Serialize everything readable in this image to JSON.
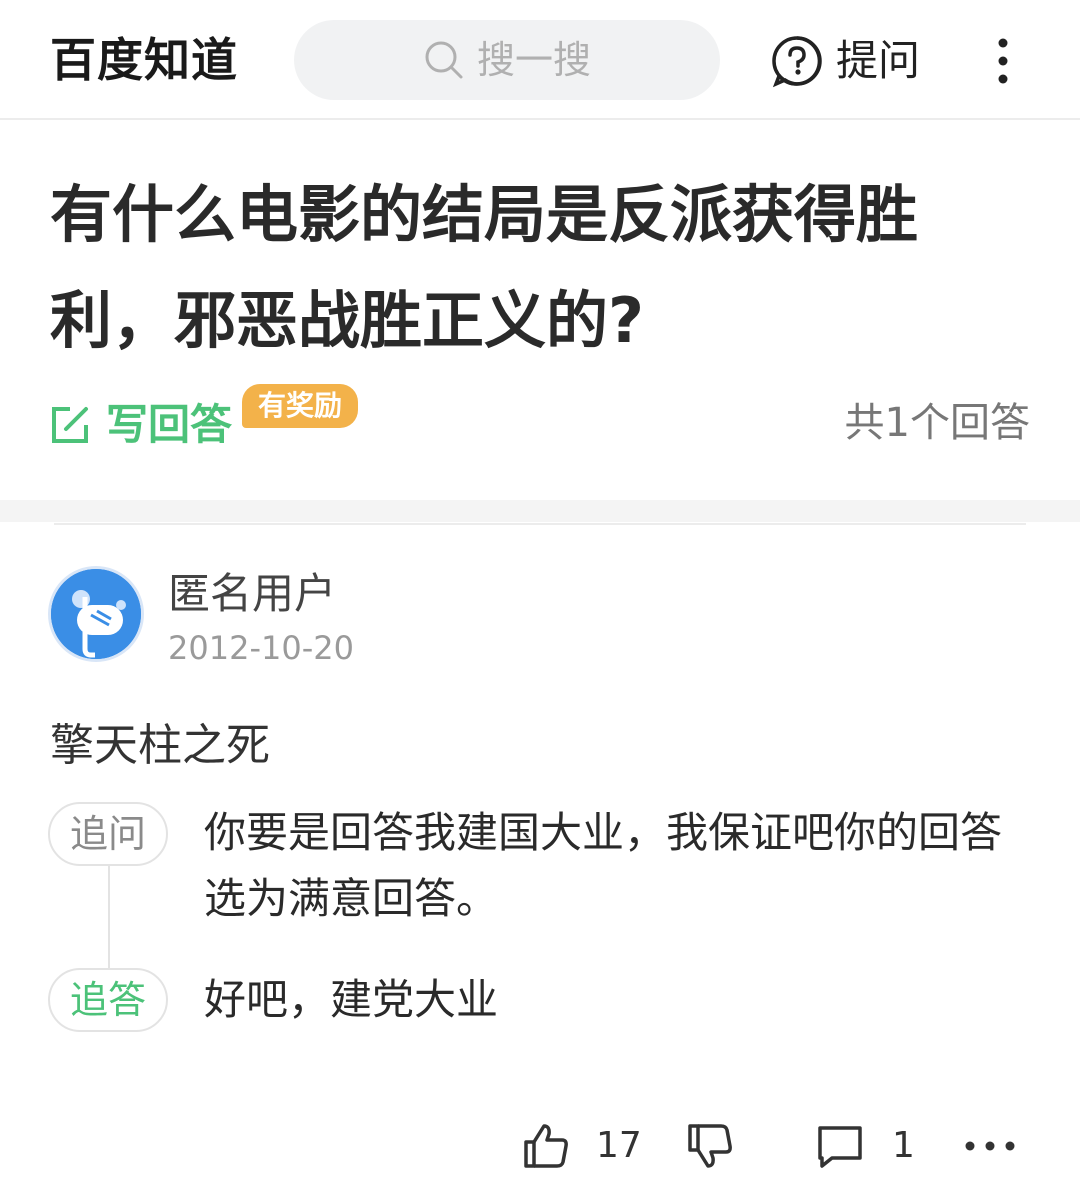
{
  "header": {
    "logo_text": "百度知道",
    "search_placeholder": "搜一搜",
    "ask_label": "提问",
    "icons": {
      "search": "search-icon",
      "ask": "question-circle-icon",
      "more": "more-vertical-icon"
    }
  },
  "question": {
    "title": "有什么电影的结局是反派获得胜利，邪恶战胜正义的?",
    "write_answer_label": "写回答",
    "reward_badge": "有奖励",
    "answer_count_label": "共1个回答"
  },
  "answer": {
    "user_name": "匿名用户",
    "date": "2012-10-20",
    "content": "擎天柱之死",
    "thread": {
      "followup_question_tag": "追问",
      "followup_question_text": "你要是回答我建国大业，我保证吧你的回答选为满意回答。",
      "followup_answer_tag": "追答",
      "followup_answer_text": "好吧，建党大业"
    },
    "actions": {
      "like_count": "17",
      "comment_count": "1"
    }
  },
  "colors": {
    "accent_green": "#4cc279",
    "reward_orange": "#f3b24a",
    "avatar_blue": "#3a8ee6"
  }
}
